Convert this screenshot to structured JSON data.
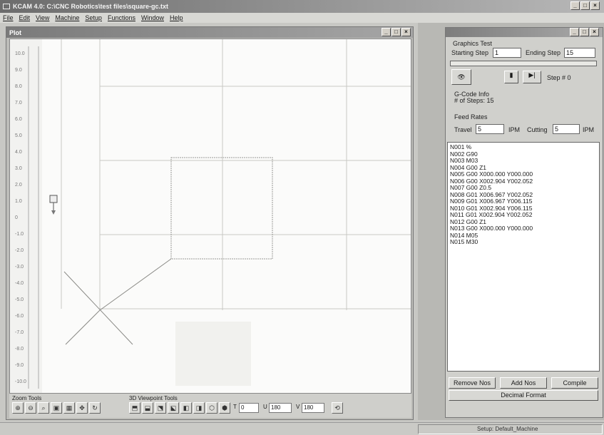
{
  "app": {
    "title": "KCAM 4.0: C:\\CNC Robotics\\test files\\square-gc.txt",
    "min": "_",
    "max": "□",
    "close": "×"
  },
  "menu": [
    "File",
    "Edit",
    "View",
    "Machine",
    "Setup",
    "Functions",
    "Window",
    "Help"
  ],
  "plot": {
    "title": "Plot",
    "ruler_labels": [
      "10.0",
      "9.0",
      "8.0",
      "7.0",
      "6.0",
      "5.0",
      "4.0",
      "3.0",
      "2.0",
      "1.0",
      "0",
      "-1.0",
      "-2.0",
      "-3.0",
      "-4.0",
      "-5.0",
      "-6.0",
      "-7.0",
      "-8.0",
      "-9.0",
      "-10.0"
    ]
  },
  "tools": {
    "zoom_label": "Zoom Tools",
    "view_label": "3D Viewpoint Tools",
    "t_label": "T",
    "t_value": "0",
    "u_label": "U",
    "u_value": "180",
    "v_label": "V",
    "v_value": "180"
  },
  "graphics": {
    "title": "",
    "section_test": "Graphics Test",
    "starting_step_label": "Starting Step",
    "starting_step": "1",
    "ending_step_label": "Ending Step",
    "ending_step": "15",
    "step_label": "Step # 0",
    "gcode_info_label": "G-Code Info",
    "num_steps_label": "# of Steps: 15",
    "feed_rates_label": "Feed Rates",
    "travel_label": "Travel",
    "travel_value": "5",
    "ipm1": "IPM",
    "cutting_label": "Cutting",
    "cutting_value": "5",
    "ipm2": "IPM",
    "gcode_lines": [
      "N001 %",
      "N002 G90",
      "N003 M03",
      "N004 G00 Z1",
      "N005 G00 X000.000 Y000.000",
      "N006 G00 X002.904 Y002.052",
      "N007 G00 Z0.5",
      "N008 G01 X006.967 Y002.052",
      "N009 G01 X006.967 Y006.115",
      "N010 G01 X002.904 Y006.115",
      "N011 G01 X002.904 Y002.052",
      "N012 G00 Z1",
      "N013 G00 X000.000 Y000.000",
      "N014 M05",
      "N015 M30"
    ],
    "remove_btn": "Remove Nos",
    "add_btn": "Add Nos",
    "compile_btn": "Compile",
    "decimal_btn": "Decimal Format"
  },
  "status": {
    "setup": "Setup: Default_Machine"
  }
}
